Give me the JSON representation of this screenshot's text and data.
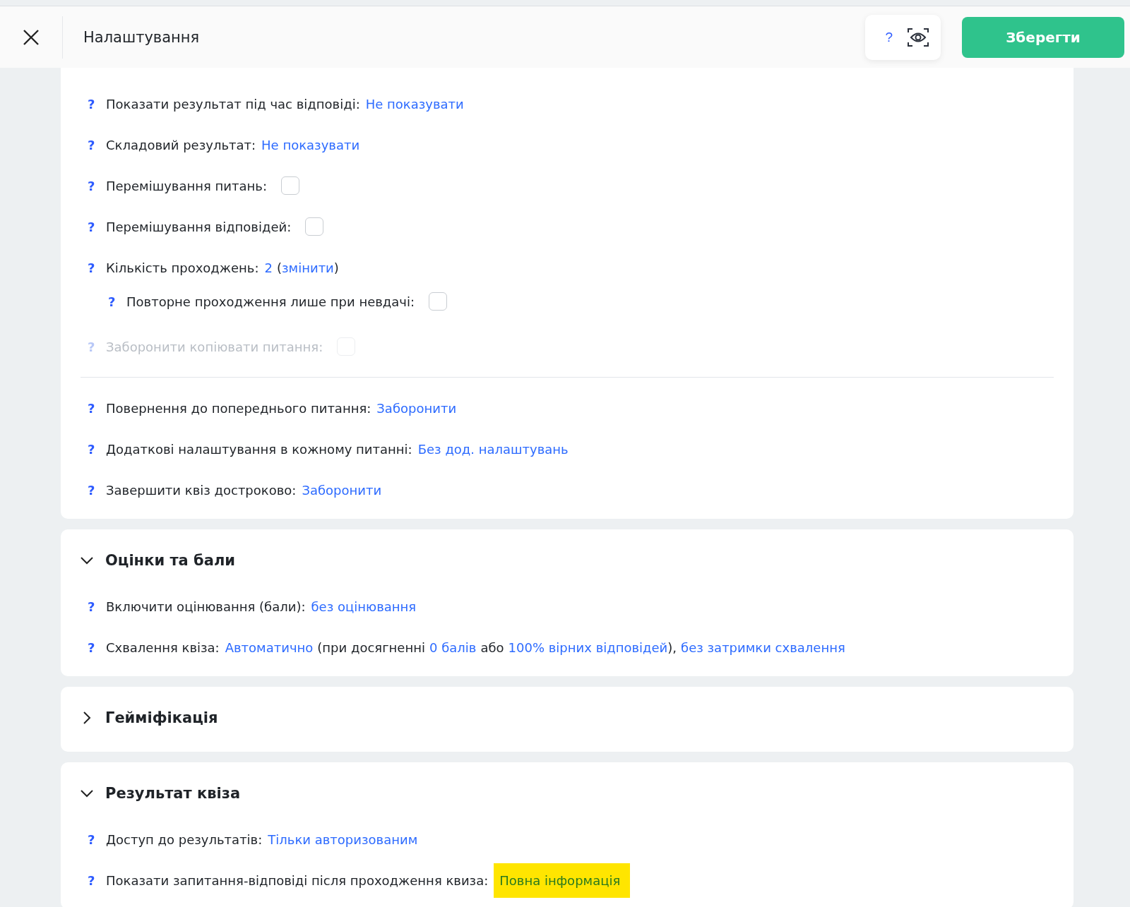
{
  "header": {
    "title": "Налаштування",
    "help": "?",
    "save_button": "Зберегти"
  },
  "sections": [
    {
      "row_groups": [
        [
          {
            "help": "?",
            "label": "Показати результат під час відповіді:",
            "disabled": false,
            "parts": [
              {
                "kind": "link",
                "text": "Не показувати"
              }
            ]
          },
          {
            "help": "?",
            "label": "Складовий результат:",
            "disabled": false,
            "parts": [
              {
                "kind": "link",
                "text": "Не показувати"
              }
            ]
          },
          {
            "help": "?",
            "label": "Перемішування питань:",
            "disabled": false,
            "checkbox": {
              "checked": false
            }
          },
          {
            "help": "?",
            "label": "Перемішування відповідей:",
            "disabled": false,
            "checkbox": {
              "checked": false
            }
          },
          {
            "help": "?",
            "label": "Кількість проходжень:",
            "disabled": false,
            "parts": [
              {
                "kind": "link",
                "text": "2"
              },
              {
                "kind": "text",
                "text": "("
              },
              {
                "kind": "link",
                "text": "змінити"
              },
              {
                "kind": "text",
                "text": ")"
              }
            ],
            "children": [
              {
                "help": "?",
                "label": "Повторне проходження лише при невдачі:",
                "disabled": false,
                "checkbox": {
                  "checked": false
                }
              }
            ]
          },
          {
            "help": "?",
            "label": "Заборонити копіювати питання:",
            "disabled": true,
            "checkbox": {
              "checked": false
            }
          }
        ],
        [
          {
            "help": "?",
            "label": "Повернення до попереднього питання:",
            "disabled": false,
            "parts": [
              {
                "kind": "link",
                "text": "Заборонити"
              }
            ]
          },
          {
            "help": "?",
            "label": "Додаткові налаштування в кожному питанні:",
            "disabled": false,
            "parts": [
              {
                "kind": "link",
                "text": "Без дод. налаштувань"
              }
            ]
          },
          {
            "help": "?",
            "label": "Завершити квіз достроково:",
            "disabled": false,
            "parts": [
              {
                "kind": "link",
                "text": "Заборонити"
              }
            ]
          }
        ]
      ]
    },
    {
      "title": "Оцінки та бали",
      "expanded": true,
      "row_groups": [
        [
          {
            "help": "?",
            "label": "Включити оцінювання (бали):",
            "disabled": false,
            "parts": [
              {
                "kind": "link",
                "text": "без оцінювання"
              }
            ]
          },
          {
            "help": "?",
            "label": "Схвалення квіза:",
            "disabled": false,
            "parts": [
              {
                "kind": "link",
                "text": "Автоматично"
              },
              {
                "kind": "text",
                "text": "(при досягненні"
              },
              {
                "kind": "link",
                "text": "0 балів"
              },
              {
                "kind": "text",
                "text": "або"
              },
              {
                "kind": "link",
                "text": "100% вірних відповідей"
              },
              {
                "kind": "text",
                "text": "),"
              },
              {
                "kind": "link",
                "text": "без затримки схвалення"
              }
            ]
          }
        ]
      ]
    },
    {
      "title": "Гейміфікація",
      "expanded": false
    },
    {
      "title": "Результат квіза",
      "expanded": true,
      "row_groups": [
        [
          {
            "help": "?",
            "label": "Доступ до результатів:",
            "disabled": false,
            "parts": [
              {
                "kind": "link",
                "text": "Тільки авторизованим"
              }
            ]
          },
          {
            "help": "?",
            "label": "Показати запитання-відповіді після проходження квиза:",
            "disabled": false,
            "parts": [
              {
                "kind": "link",
                "text": "Повна інформація",
                "highlighted": true
              }
            ]
          }
        ]
      ]
    }
  ]
}
